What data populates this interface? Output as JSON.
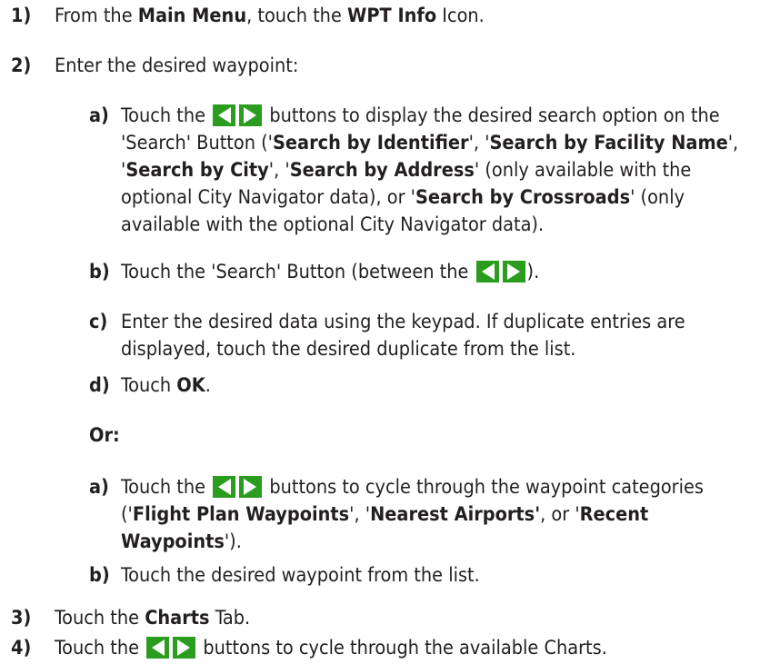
{
  "steps": {
    "s1": {
      "num": "1)",
      "pre": "From the ",
      "b1": "Main Menu",
      "mid": ", touch the ",
      "b2": "WPT Info",
      "post": " Icon."
    },
    "s2": {
      "num": "2)",
      "text": "Enter the desired waypoint:"
    },
    "a1": {
      "num": "a)",
      "l1_pre": "Touch the ",
      "l1_post": " buttons to display the desired search option on the",
      "l2_pre": "'Search' Button ('",
      "l2_b1": "Search by Identifier",
      "l2_mid": "', '",
      "l2_b2": "Search by Facility Name",
      "l2_post": "',",
      "l3_pre": "'",
      "l3_b1": "Search by City",
      "l3_mid": "',  '",
      "l3_b2": "Search by Address",
      "l3_post": "' (only available with the",
      "l4_pre": "optional City Navigator data), or '",
      "l4_b": "Search by Crossroads",
      "l4_post": "' (only",
      "l5": "available with the optional City Navigator data)."
    },
    "b1": {
      "num": "b)",
      "pre": "Touch the 'Search' Button (between the ",
      "post": ")."
    },
    "c1": {
      "num": "c)",
      "l1": "Enter the desired data using the keypad.  If duplicate entries are",
      "l2": "displayed, touch the desired duplicate from the list."
    },
    "d1": {
      "num": "d)",
      "pre": "Touch ",
      "b": "OK",
      "post": "."
    },
    "or": "Or:",
    "a2": {
      "num": "a)",
      "l1_pre": "Touch the ",
      "l1_post": " buttons to cycle through the waypoint categories",
      "l2_pre": "('",
      "l2_b1": "Flight Plan Waypoints",
      "l2_mid": "', '",
      "l2_b2": "Nearest Airports'",
      "l2_mid2": ", or '",
      "l2_b3": "Recent",
      "l3_b": "Waypoints",
      "l3_post": "')."
    },
    "b2": {
      "num": "b)",
      "text": "Touch the desired waypoint from the list."
    },
    "s3": {
      "num": "3)",
      "pre": "Touch the ",
      "b": "Charts",
      "post": " Tab."
    },
    "s4": {
      "num": "4)",
      "pre": "Touch the  ",
      "post": " buttons to cycle through the available Charts."
    }
  },
  "icons": {
    "arrow_buttons": "left-right-arrow-buttons-icon",
    "color": "#2a9d1e"
  }
}
